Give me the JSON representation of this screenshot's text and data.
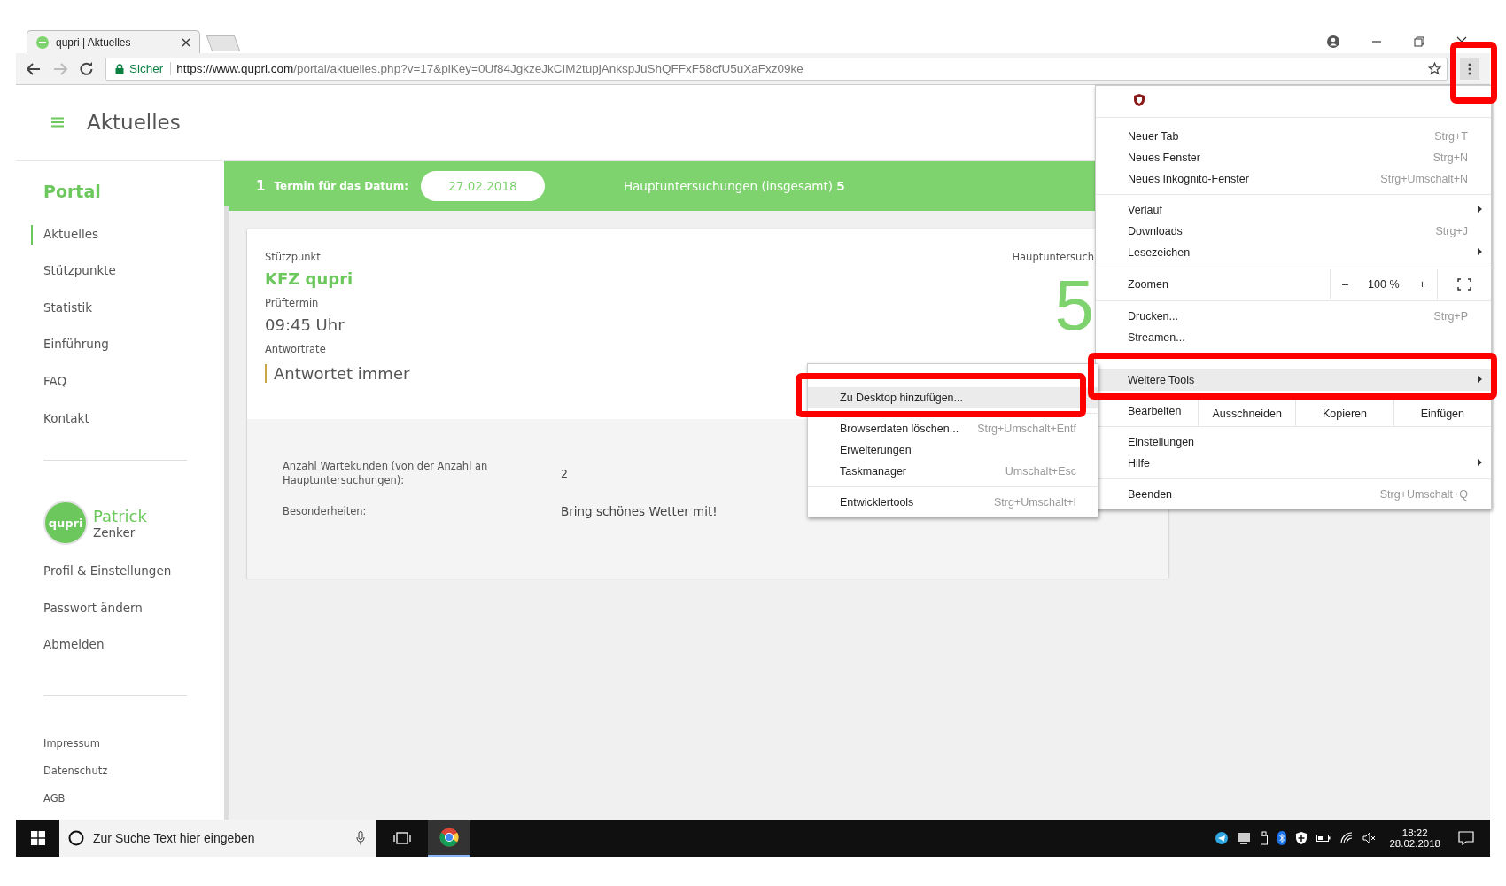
{
  "browser": {
    "tab_title": "qupri | Aktuelles",
    "security_label": "Sicher",
    "url_host": "https://www.qupri.com",
    "url_path": "/portal/aktuelles.php?v=17&piKey=0Uf84JgkzeJkCIM2tupjAnkspJuShQFFxF58cfU5uXaFxz09ke"
  },
  "page": {
    "title": "Aktuelles"
  },
  "sidebar": {
    "section_title": "Portal",
    "items": [
      {
        "label": "Aktuelles",
        "selected": true
      },
      {
        "label": "Stützpunkte",
        "selected": false
      },
      {
        "label": "Statistik",
        "selected": false
      },
      {
        "label": "Einführung",
        "selected": false
      },
      {
        "label": "FAQ",
        "selected": false
      },
      {
        "label": "Kontakt",
        "selected": false
      }
    ],
    "user": {
      "avatar_text": "qupri",
      "first_name": "Patrick",
      "last_name": "Zenker"
    },
    "account_links": [
      "Profil & Einstellungen",
      "Passwort ändern",
      "Abmelden"
    ],
    "footer_links": [
      "Impressum",
      "Datenschutz",
      "AGB"
    ]
  },
  "summary_bar": {
    "count": "1",
    "label": "Termin für das Datum:",
    "date": "27.02.2018",
    "total_text": "Hauptuntersuchungen (insgesamt) **5**"
  },
  "card": {
    "station_label": "Stützpunkt",
    "station": "KFZ qupri",
    "time_label": "Prüftermin",
    "time": "09:45 Uhr",
    "response_label": "Antwortrate",
    "response": "Antwortet immer",
    "count_label": "Hauptuntersuch",
    "count": "5",
    "details": [
      {
        "label": "Anzahl Wartekunden (von der Anzahl an Hauptuntersuchungen):",
        "value": "2"
      },
      {
        "label": "Besonderheiten:",
        "value": "Bring schönes Wetter mit!"
      }
    ]
  },
  "browser_menu": {
    "items": [
      {
        "kind": "item",
        "label": "Neuer Tab",
        "shortcut": "Strg+T",
        "submenu": false,
        "selected": false
      },
      {
        "kind": "item",
        "label": "Neues Fenster",
        "shortcut": "Strg+N",
        "submenu": false,
        "selected": false
      },
      {
        "kind": "item",
        "label": "Neues Inkognito-Fenster",
        "shortcut": "Strg+Umschalt+N",
        "submenu": false,
        "selected": false
      },
      {
        "kind": "separator"
      },
      {
        "kind": "item",
        "label": "Verlauf",
        "submenu": true,
        "selected": false
      },
      {
        "kind": "item",
        "label": "Downloads",
        "shortcut": "Strg+J",
        "submenu": false,
        "selected": false
      },
      {
        "kind": "item",
        "label": "Lesezeichen",
        "submenu": true,
        "selected": false
      },
      {
        "kind": "separator"
      },
      {
        "kind": "zoom",
        "label": "Zoomen",
        "minus": "–",
        "value": "100 %",
        "plus": "+"
      },
      {
        "kind": "separator"
      },
      {
        "kind": "item",
        "label": "Drucken...",
        "shortcut": "Strg+P",
        "submenu": false,
        "selected": false
      },
      {
        "kind": "item",
        "label": "Streamen...",
        "submenu": false,
        "selected": false
      },
      {
        "kind": "gap"
      },
      {
        "kind": "item",
        "label": "Weitere Tools",
        "submenu": true,
        "selected": true
      },
      {
        "kind": "edit",
        "label": "Bearbeiten",
        "actions": [
          "Ausschneiden",
          "Kopieren",
          "Einfügen"
        ]
      },
      {
        "kind": "item",
        "label": "Einstellungen",
        "submenu": false,
        "selected": false
      },
      {
        "kind": "item",
        "label": "Hilfe",
        "submenu": true,
        "selected": false
      },
      {
        "kind": "separator"
      },
      {
        "kind": "item",
        "label": "Beenden",
        "shortcut": "Strg+Umschalt+Q",
        "submenu": false,
        "selected": false
      }
    ]
  },
  "submenu": {
    "items": [
      {
        "kind": "gap"
      },
      {
        "kind": "item",
        "label": "Zu Desktop hinzufügen...",
        "selected": true
      },
      {
        "kind": "separator"
      },
      {
        "kind": "item",
        "label": "Browserdaten löschen...",
        "shortcut": "Strg+Umschalt+Entf",
        "selected": false
      },
      {
        "kind": "item",
        "label": "Erweiterungen",
        "selected": false
      },
      {
        "kind": "item",
        "label": "Taskmanager",
        "shortcut": "Umschalt+Esc",
        "selected": false
      },
      {
        "kind": "separator"
      },
      {
        "kind": "item",
        "label": "Entwicklertools",
        "shortcut": "Strg+Umschalt+I",
        "selected": false
      }
    ]
  },
  "taskbar": {
    "search_placeholder": "Zur Suche Text hier eingeben",
    "time": "18:22",
    "date": "28.02.2018"
  }
}
